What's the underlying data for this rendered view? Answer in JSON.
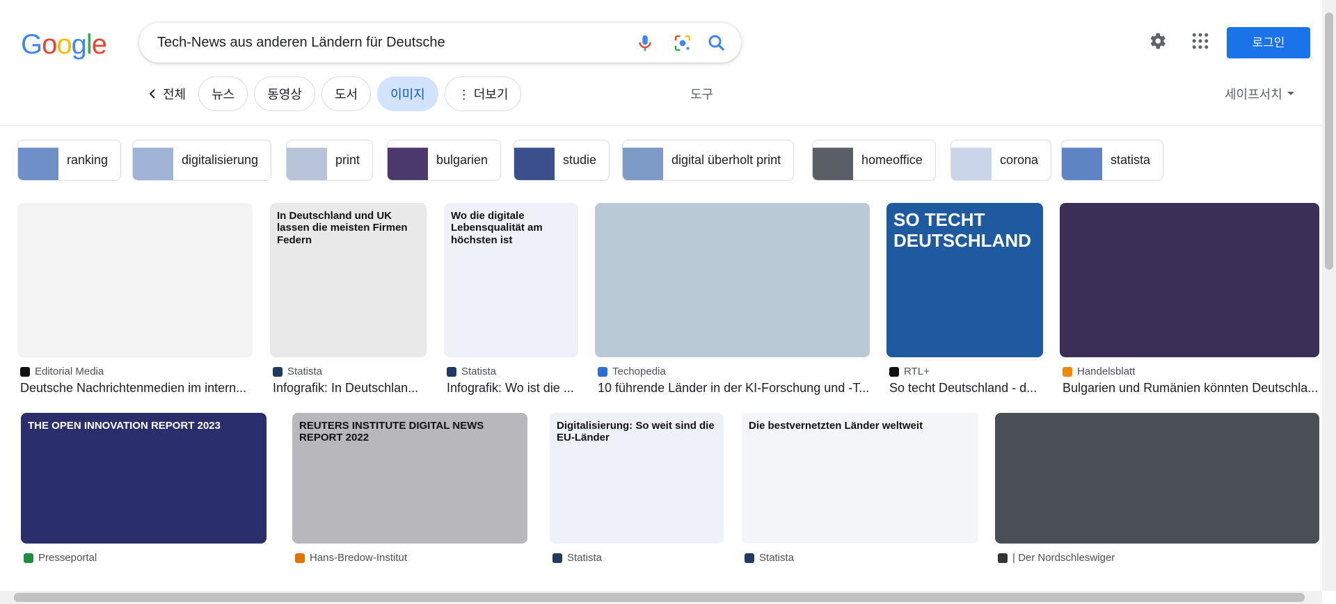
{
  "header": {
    "logo_letters": [
      {
        "char": "G",
        "color": "#4285F4"
      },
      {
        "char": "o",
        "color": "#EA4335"
      },
      {
        "char": "o",
        "color": "#FBBC05"
      },
      {
        "char": "g",
        "color": "#4285F4"
      },
      {
        "char": "l",
        "color": "#34A853"
      },
      {
        "char": "e",
        "color": "#EA4335"
      }
    ],
    "search_value": "Tech-News aus anderen Ländern für Deutsche",
    "login_label": "로그인",
    "icons": [
      "mic-icon",
      "lens-icon",
      "search-icon",
      "settings-gear-icon",
      "apps-grid-icon"
    ]
  },
  "tabs": {
    "back_label": "전체",
    "items": [
      "뉴스",
      "동영상",
      "도서",
      "이미지",
      "⋮ 더보기"
    ],
    "active": "이미지",
    "tools_label": "도구",
    "safesearch_label": "세이프서치"
  },
  "refine_chips": [
    {
      "label": "ranking",
      "thumb": "#6f8fc9"
    },
    {
      "label": "digitalisierung",
      "thumb": "#9fb4d6"
    },
    {
      "label": "print",
      "thumb": "#b7c4d9"
    },
    {
      "label": "bulgarien",
      "thumb": "#4a3a6b"
    },
    {
      "label": "studie",
      "thumb": "#3a4f8c"
    },
    {
      "label": "digital überholt print",
      "thumb": "#7e9bc7"
    },
    {
      "label": "homeoffice",
      "thumb": "#5a5f66"
    },
    {
      "label": "corona",
      "thumb": "#c9d6ea"
    },
    {
      "label": "statista",
      "thumb": "#5f84c4"
    }
  ],
  "results_row1": [
    {
      "source": "Editorial Media",
      "title": "Deutsche Nachrichtenmedien im intern...",
      "fav": "#111111",
      "img_bg": "#f4f4f4"
    },
    {
      "source": "Statista",
      "title": "Infografik: In Deutschlan...",
      "fav": "#1f3a63",
      "img_bg": "#e9e9e9",
      "img_text": "In Deutschland und UK lassen die meisten Firmen Federn"
    },
    {
      "source": "Statista",
      "title": "Infografik: Wo ist die ...",
      "fav": "#1f3a63",
      "img_bg": "#eef2f8",
      "img_text": "Wo die digitale Lebensqualität am höchsten ist"
    },
    {
      "source": "Techopedia",
      "title": "10 führende Länder in der KI-Forschung und -T...",
      "fav": "#2b6fd6",
      "img_bg": "#b9c9d6"
    },
    {
      "source": "RTL+",
      "title": "So techt Deutschland - d...",
      "fav": "#111111",
      "img_bg": "#1f5aa0",
      "img_text": "SO TECHT DEUTSCHLAND"
    },
    {
      "source": "Handelsblatt",
      "title": "Bulgarien und Rumänien könnten Deutschla...",
      "fav": "#f08a00",
      "img_bg": "#3c2f57"
    }
  ],
  "results_row2": [
    {
      "source": "Presseportal",
      "fav": "#1e8e3e",
      "img_bg": "#2a2f6b",
      "img_text": "THE OPEN INNOVATION REPORT 2023"
    },
    {
      "source": "Hans-Bredow-Institut",
      "fav": "#e37400",
      "img_bg": "#b8b8bc",
      "img_text": "REUTERS INSTITUTE DIGITAL NEWS REPORT 2022"
    },
    {
      "source": "Statista",
      "fav": "#1f3a63",
      "img_bg": "#eef2f8",
      "img_text": "Digitalisierung: So weit sind die EU-Länder"
    },
    {
      "source": "Statista",
      "fav": "#1f3a63",
      "img_bg": "#f3f5f9",
      "img_text": "Die bestvernetzten Länder weltweit"
    },
    {
      "source": "| Der Nordschleswiger",
      "fav": "#333333",
      "img_bg": "#4a4f55"
    }
  ]
}
